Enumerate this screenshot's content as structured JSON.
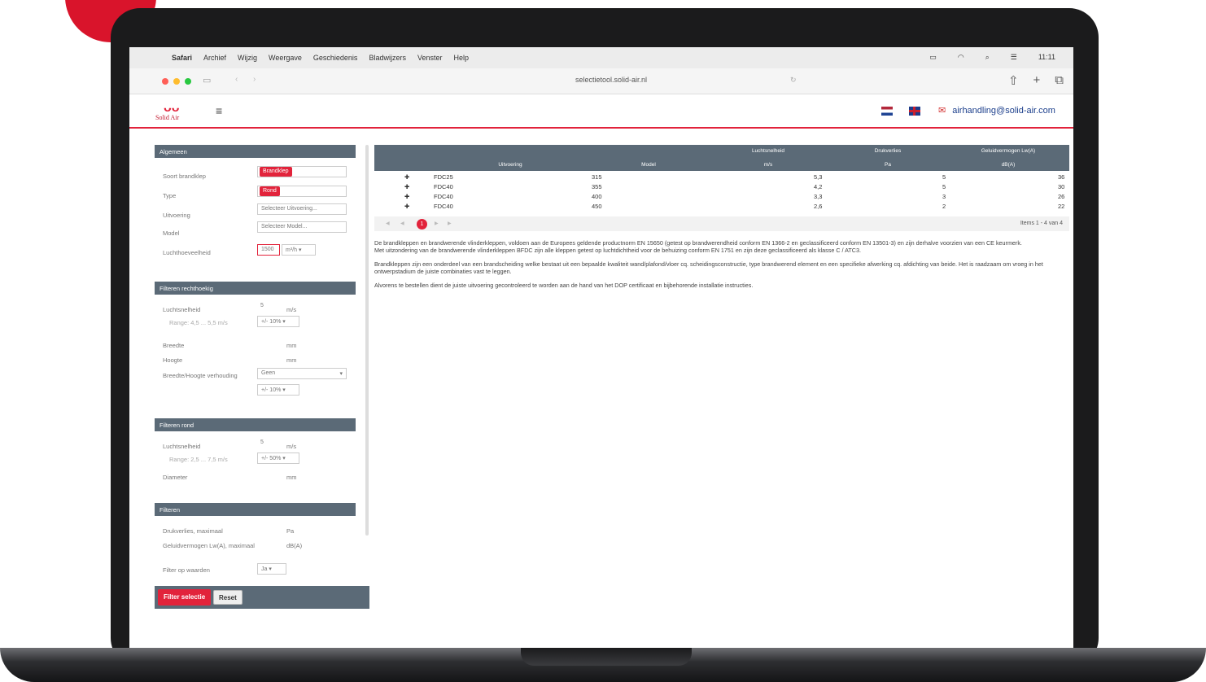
{
  "menubar": {
    "apple": "",
    "items": [
      "Safari",
      "Archief",
      "Wijzig",
      "Weergave",
      "Geschiedenis",
      "Bladwijzers",
      "Venster",
      "Help"
    ],
    "clock": "11:11"
  },
  "browser": {
    "url": "selectietool.solid-air.nl"
  },
  "header": {
    "logo_text": "Solid Air",
    "email": "airhandling@solid-air.com"
  },
  "sidebar": {
    "sections": {
      "algemeen": "Algemeen",
      "rechthoekig": "Filteren rechthoekig",
      "rond": "Filteren rond",
      "filteren": "Filteren"
    },
    "algemeen": {
      "soort_label": "Soort brandklep",
      "soort_value": "Brandklep",
      "type_label": "Type",
      "type_value": "Rond",
      "uitvoering_label": "Uitvoering",
      "uitvoering_placeholder": "Selecteer Uitvoering...",
      "model_label": "Model",
      "model_placeholder": "Selecteer Model...",
      "lucht_label": "Luchthoeveelheid",
      "lucht_value": "1500",
      "lucht_unit": "m³/h"
    },
    "rechthoekig": {
      "snelheid_label": "Luchtsnelheid",
      "snelheid_value": "5",
      "snelheid_unit": "m/s",
      "range": "Range: 4,5 ... 5,5 m/s",
      "tolerance": "+/- 10%",
      "breedte_label": "Breedte",
      "breedte_unit": "mm",
      "hoogte_label": "Hoogte",
      "hoogte_unit": "mm",
      "verhouding_label": "Breedte/Hoogte verhouding",
      "verhouding_value": "Geen",
      "tolerance2": "+/- 10%"
    },
    "rond": {
      "snelheid_label": "Luchtsnelheid",
      "snelheid_value": "5",
      "snelheid_unit": "m/s",
      "range": "Range: 2,5 ... 7,5 m/s",
      "tolerance": "+/- 50%",
      "diameter_label": "Diameter",
      "diameter_unit": "mm"
    },
    "filteren": {
      "druk_label": "Drukverlies, maximaal",
      "druk_unit": "Pa",
      "geluid_label": "Geluidvermogen Lw(A), maximaal",
      "geluid_unit": "dB(A)",
      "waarden_label": "Filter op waarden",
      "waarden_value": "Ja"
    },
    "buttons": {
      "filter": "Filter selectie",
      "reset": "Reset"
    }
  },
  "table": {
    "group_headers": [
      "Luchtsnelheid",
      "Drukverlies",
      "Geluidvermogen Lw(A)"
    ],
    "headers": [
      "Uitvoering",
      "Model"
    ],
    "units": [
      "m/s",
      "Pa",
      "dB(A)"
    ],
    "rows": [
      {
        "uitvoering": "FDC25",
        "model": "315",
        "snelheid": "5,3",
        "druk": "5",
        "geluid": "36"
      },
      {
        "uitvoering": "FDC40",
        "model": "355",
        "snelheid": "4,2",
        "druk": "5",
        "geluid": "30"
      },
      {
        "uitvoering": "FDC40",
        "model": "400",
        "snelheid": "3,3",
        "druk": "3",
        "geluid": "26"
      },
      {
        "uitvoering": "FDC40",
        "model": "450",
        "snelheid": "2,6",
        "druk": "2",
        "geluid": "22"
      }
    ],
    "current_page": "1",
    "items_info": "Items 1 - 4 van 4"
  },
  "description": {
    "p1": "De brandkleppen en brandwerende vlinderkleppen, voldoen aan de Europees geldende productnorm EN 15650 (getest op brandwerendheid conform EN 1366-2 en geclassificeerd conform EN 13501-3) en zijn derhalve voorzien van een CE keurmerk.",
    "p2": "Met uitzondering van de brandwerende vlinderkleppen BFDC zijn alle kleppen getest op luchtdichtheid voor de behuizing conform EN 1751 en zijn deze geclassificeerd als klasse C / ATC3.",
    "p3": "Brandkleppen zijn een onderdeel van een brandscheiding welke bestaat uit een bepaalde kwaliteit wand/plafond/vloer cq. scheidingsconstructie, type brandwerend element en een specifieke afwerking cq. afdichting van beide. Het is raadzaam om vroeg in het ontwerpstadium de juiste combinaties vast te leggen.",
    "p4": "Alvorens te bestellen dient de juiste uitvoering gecontroleerd te worden aan de hand van het DOP certificaat en bijbehorende installatie instructies."
  }
}
